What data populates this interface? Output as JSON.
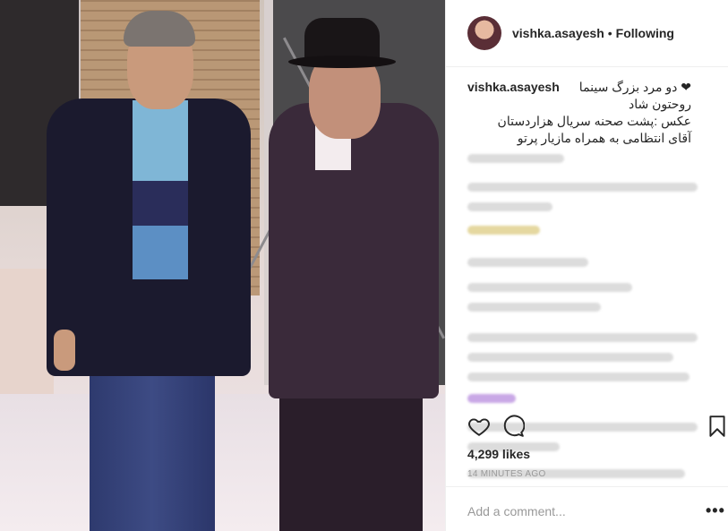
{
  "header": {
    "username": "vishka.asayesh",
    "separator": "•",
    "follow_status": "Following"
  },
  "caption": {
    "username": "vishka.asayesh",
    "lines": [
      "❤ دو مرد بزرگ سینما",
      "روحتون شاد",
      "عکس :پشت صحنه سریال هزاردستان",
      "آقای انتظامی به همراه مازیار پرتو"
    ]
  },
  "post": {
    "likes": "4,299 likes",
    "timestamp": "14 MINUTES AGO"
  },
  "comment_box": {
    "placeholder": "Add a comment...",
    "more": "•••"
  },
  "colors": {
    "text": "#262626",
    "muted": "#999999",
    "divider": "#efefef"
  },
  "icons": [
    "heart-icon",
    "comment-icon",
    "bookmark-icon",
    "more-options-icon"
  ]
}
